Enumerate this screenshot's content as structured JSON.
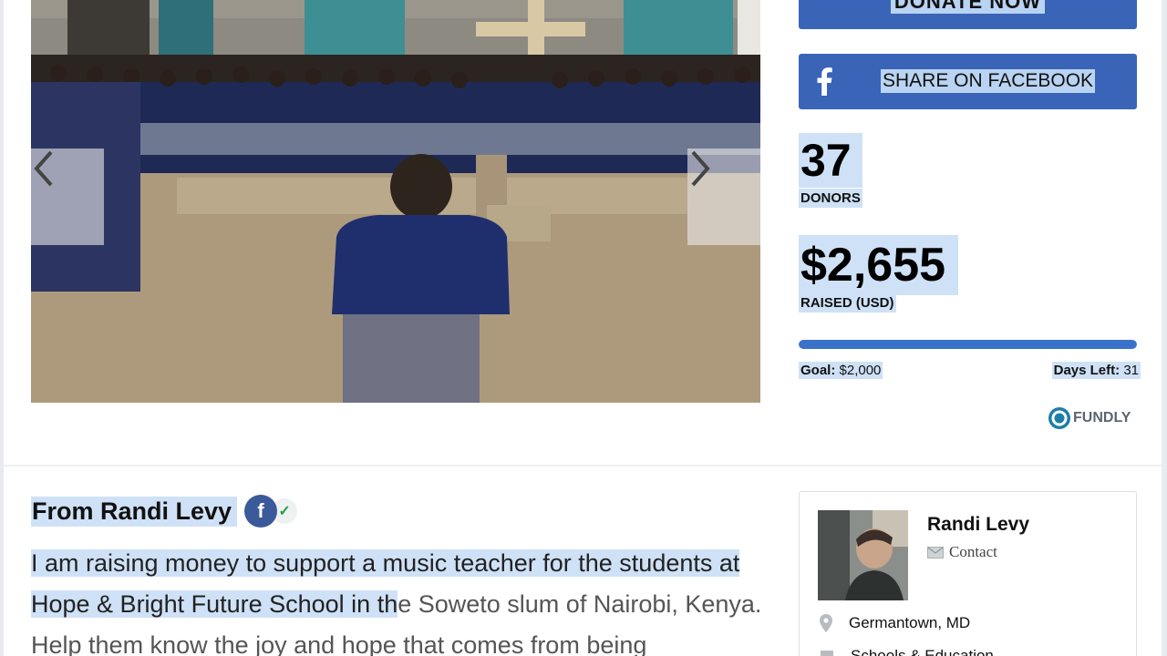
{
  "donate": {
    "label": "DONATE NOW"
  },
  "share": {
    "label": "SHARE ON FACEBOOK"
  },
  "stats": {
    "donors_count": "37",
    "donors_label": "DONORS",
    "raised_amount": "$2,655",
    "raised_label": "RAISED (USD)",
    "progress_fraction": 1.0,
    "goal_label": "Goal:",
    "goal_value": "$2,000",
    "days_left_label": "Days Left:",
    "days_left_value": "31"
  },
  "brand": {
    "name": "FUNDLY"
  },
  "story": {
    "from_title": "From Randi Levy",
    "fb_letter": "f",
    "text_selected": "I am raising money to support a music teacher for the students at Hope & Bright Future School in th",
    "text_rest": "e Soweto slum of Nairobi, Kenya. Help them know the joy and hope that comes from being"
  },
  "organizer": {
    "name": "Randi Levy",
    "contact_label": "Contact",
    "location": "Germantown, MD",
    "category": "Schools & Education"
  },
  "colors": {
    "primary_button": "#3a64b7",
    "selection": "#cfe1f6",
    "progress": "#3a72c9",
    "facebook": "#3b5a9a"
  }
}
